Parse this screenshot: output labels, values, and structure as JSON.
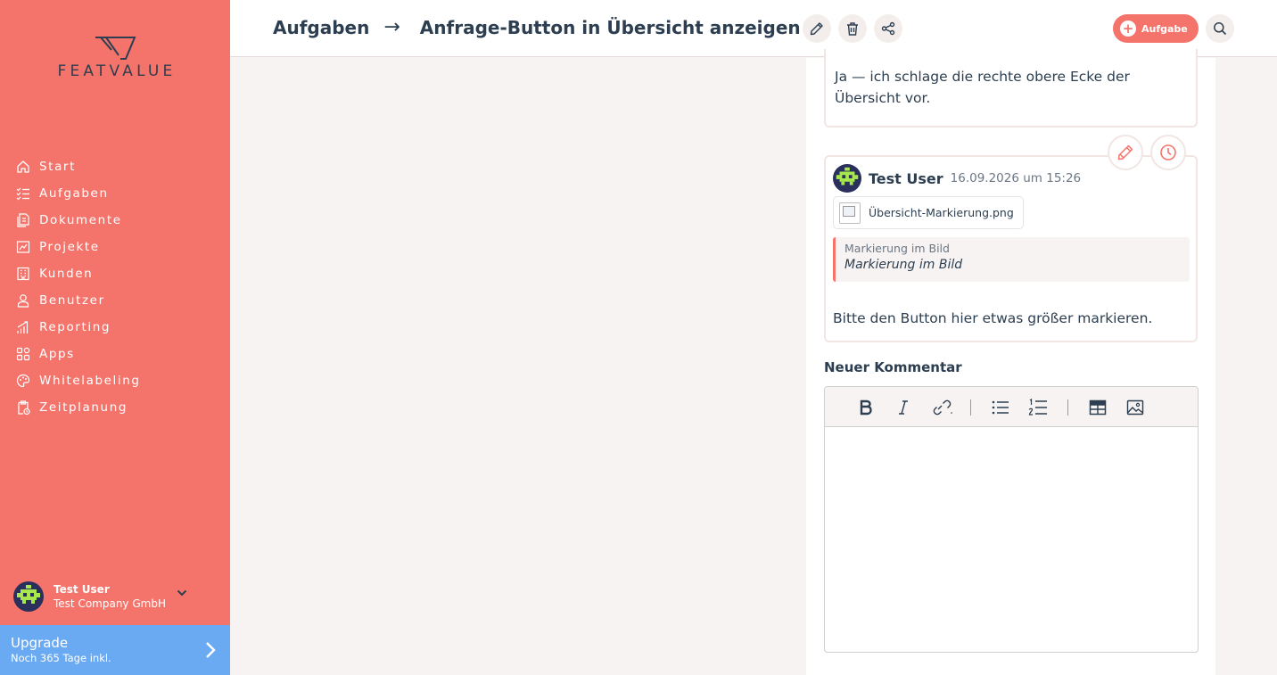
{
  "brand": {
    "logo_text": "FEATVALUE",
    "accent": "#f4746b",
    "upgrade_color": "#6aaaf3",
    "text_color": "#2c3e50"
  },
  "sidebar": {
    "items": [
      {
        "label": "Start",
        "icon": "home-icon"
      },
      {
        "label": "Aufgaben",
        "icon": "tasks-icon"
      },
      {
        "label": "Dokumente",
        "icon": "documents-icon"
      },
      {
        "label": "Projekte",
        "icon": "projects-icon"
      },
      {
        "label": "Kunden",
        "icon": "building-icon"
      },
      {
        "label": "Benutzer",
        "icon": "user-icon"
      },
      {
        "label": "Reporting",
        "icon": "chart-icon"
      },
      {
        "label": "Apps",
        "icon": "apps-icon"
      },
      {
        "label": "Whitelabeling",
        "icon": "palette-icon"
      },
      {
        "label": "Zeitplanung",
        "icon": "schedule-icon"
      }
    ],
    "user": {
      "name": "Test User",
      "company": "Test Company GmbH"
    },
    "upgrade": {
      "title": "Upgrade",
      "subtitle": "Noch 365 Tage inkl."
    }
  },
  "header": {
    "section": "Aufgaben",
    "separator": "→",
    "title": "Anfrage-Button in Übersicht anzeigen",
    "add_task_label": "Aufgabe"
  },
  "comments": [
    {
      "text": "Ja — ich schlage die rechte obere Ecke der Übersicht vor."
    },
    {
      "author": "Test User",
      "date": "16.09.2026 um 15:26",
      "attachment": "Übersicht-Markierung.png",
      "quote_label": "Markierung im Bild",
      "quote_text": "Markierung im Bild",
      "text": "Bitte den Button hier etwas größer markieren."
    }
  ],
  "new_comment": {
    "label": "Neuer Kommentar"
  }
}
